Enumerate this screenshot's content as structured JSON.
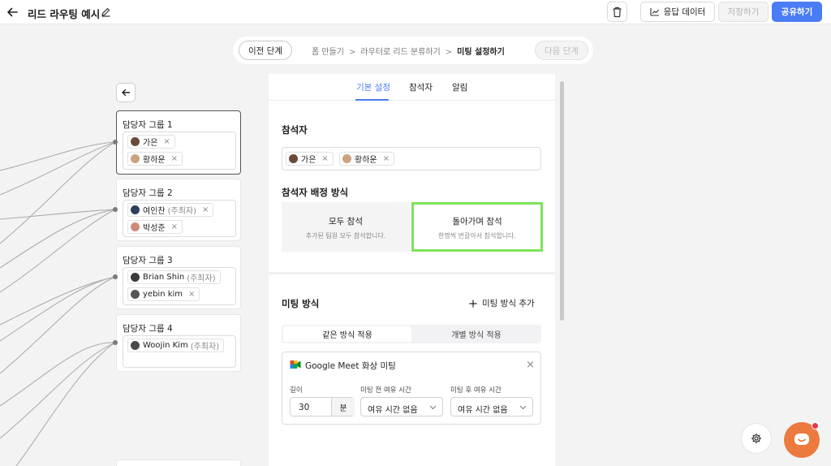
{
  "header": {
    "title": "리드 라우팅 예시",
    "response_data_label": "응답 데이터",
    "save_label": "저장하기",
    "share_label": "공유하기"
  },
  "steps": {
    "prev_label": "이전 단계",
    "crumbs": [
      "폼 만들기",
      "라우터로 리드 분류하기",
      "미팅 설정하기"
    ],
    "separator": ">",
    "next_label": "다음 단계"
  },
  "groups": [
    {
      "title": "담당자 그룹 1",
      "members": [
        {
          "name": "가은",
          "role": ""
        },
        {
          "name": "황하운",
          "role": ""
        }
      ]
    },
    {
      "title": "담당자 그룹 2",
      "members": [
        {
          "name": "여인찬",
          "role": "(주최자)"
        },
        {
          "name": "박성준",
          "role": ""
        }
      ]
    },
    {
      "title": "담당자 그룹 3",
      "members": [
        {
          "name": "Brian Shin",
          "role": "(주최자)"
        },
        {
          "name": "yebin kim",
          "role": ""
        }
      ]
    },
    {
      "title": "담당자 그룹 4",
      "members": [
        {
          "name": "Woojin Kim",
          "role": "(주최자)"
        }
      ]
    }
  ],
  "remove_glyph": "×",
  "panel": {
    "tabs": [
      "기본 설정",
      "참석자",
      "알림"
    ],
    "active_tab": "기본 설정",
    "attendees_title": "참석자",
    "attendees": [
      "가은",
      "황하운"
    ],
    "assignment_title": "참석자 배정 방식",
    "modes": [
      {
        "title": "모두 참석",
        "desc": "추가된 팀원 모두 참석합니다."
      },
      {
        "title": "돌아가며 참석",
        "desc": "한명씩 번갈아서 참석합니다."
      }
    ],
    "selected_mode": "돌아가며 참석",
    "meeting_title": "미팅 방식",
    "add_method_label": "미팅 방식 추가",
    "segments": [
      "같은 방식 적용",
      "개별 방식 적용"
    ],
    "meet": {
      "name": "Google Meet 화상 미팅",
      "length_label": "길이",
      "length_value": "30",
      "length_unit": "분",
      "before_label": "미팅 전 여유 시간",
      "before_value": "여유 시간 없음",
      "after_label": "미팅 후 여유 시간",
      "after_value": "여유 시간 없음"
    }
  },
  "colors": {
    "accent": "#4a7cf6",
    "highlight": "#7ce35b",
    "chat": "#ec7a3f"
  }
}
